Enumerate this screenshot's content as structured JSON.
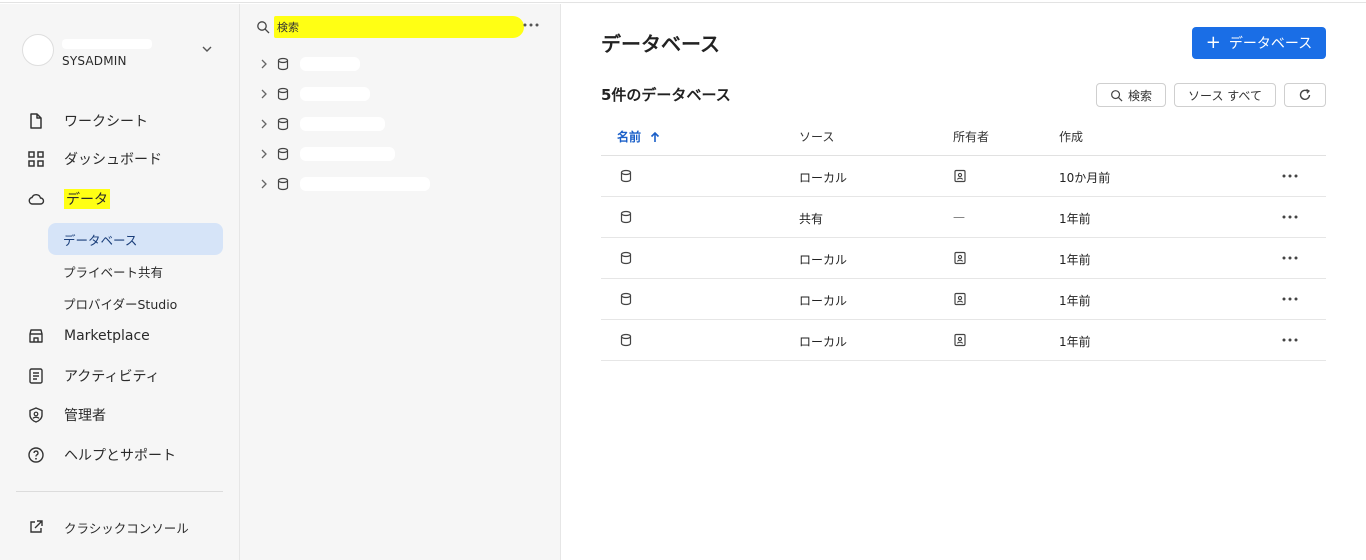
{
  "sidebar": {
    "user_role": "SYSADMIN",
    "nav": [
      {
        "label": "ワークシート",
        "icon": "file-icon"
      },
      {
        "label": "ダッシュボード",
        "icon": "grid-icon"
      },
      {
        "label": "データ",
        "icon": "cloud-icon",
        "highlighted": true
      },
      {
        "label": "Marketplace",
        "icon": "store-icon"
      },
      {
        "label": "アクティビティ",
        "icon": "activity-icon"
      },
      {
        "label": "管理者",
        "icon": "shield-icon"
      },
      {
        "label": "ヘルプとサポート",
        "icon": "help-icon"
      }
    ],
    "data_sub": [
      "データベース",
      "プライベート共有",
      "プロバイダーStudio"
    ],
    "classic_console": "クラシックコンソール"
  },
  "tree": {
    "search_placeholder": "検索"
  },
  "main": {
    "title": "データベース",
    "add_button": "データベース",
    "count_label": "5件のデータベース",
    "search_button": "検索",
    "source_filter": "ソース すべて",
    "columns": [
      "名前",
      "ソース",
      "所有者",
      "作成"
    ],
    "rows": [
      {
        "source": "ローカル",
        "owner": "owner-icon",
        "created": "10か月前"
      },
      {
        "source": "共有",
        "owner": "—",
        "created": "1年前"
      },
      {
        "source": "ローカル",
        "owner": "owner-icon",
        "created": "1年前"
      },
      {
        "source": "ローカル",
        "owner": "owner-icon",
        "created": "1年前"
      },
      {
        "source": "ローカル",
        "owner": "owner-icon",
        "created": "1年前"
      }
    ]
  },
  "colors": {
    "accent": "#1a6ee6",
    "highlight": "#ffff14",
    "active_bg": "#d6e4f8"
  }
}
